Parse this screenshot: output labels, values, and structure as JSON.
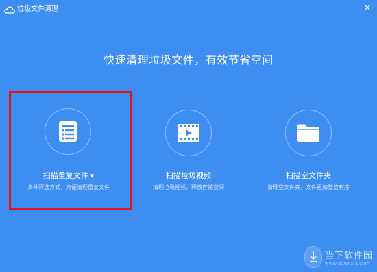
{
  "window": {
    "title": "垃圾文件清理",
    "close_icon": "close-icon"
  },
  "main": {
    "headline": "快速清理垃圾文件，有效节省空间"
  },
  "cards": [
    {
      "icon": "document-list-icon",
      "label": "扫描重复文件",
      "caret": "▼",
      "desc": "多种筛选方式，方便清理重复文件"
    },
    {
      "icon": "film-play-icon",
      "label": "扫描垃圾视频",
      "desc": "清理垃圾视频，释放存储空间"
    },
    {
      "icon": "folder-icon",
      "label": "扫描空文件夹",
      "desc": "清理空文件夹，文件更加整洁有序"
    }
  ],
  "watermark": {
    "text": "当下软件园",
    "url_text": "www.downxia.com"
  },
  "colors": {
    "background": "#3d8ef0",
    "highlight_border": "#e4141b"
  }
}
